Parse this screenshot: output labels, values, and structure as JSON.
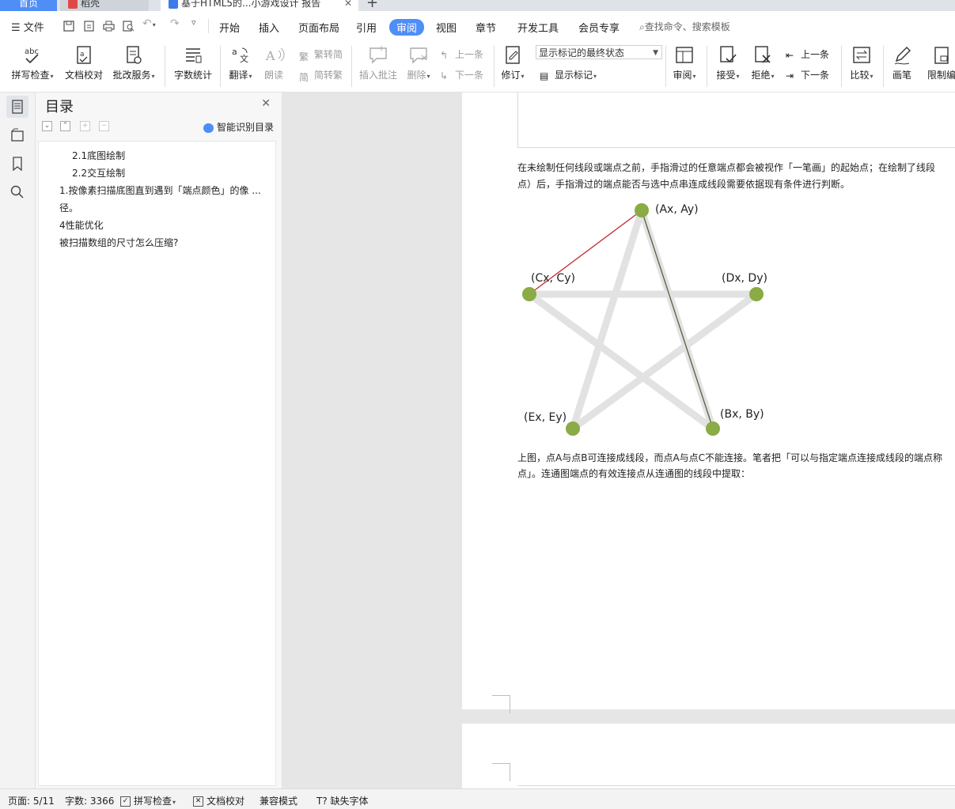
{
  "tabs": {
    "home": "首页",
    "daoke": "稻壳",
    "doc": "基于HTML5的...小游戏设计 报告"
  },
  "menu": {
    "file": "文件",
    "items": [
      "开始",
      "插入",
      "页面布局",
      "引用",
      "审阅",
      "视图",
      "章节",
      "开发工具",
      "会员专享"
    ],
    "active": "审阅",
    "search": "查找命令、搜索模板"
  },
  "ribbon": {
    "spell": "拼写检查",
    "proof": "文档校对",
    "review_service": "批改服务",
    "word_count": "字数统计",
    "translate": "翻译",
    "read_aloud": "朗读",
    "trad_to_simp": "繁转简",
    "simp_to_trad": "简转繁",
    "insert_comment": "插入批注",
    "delete": "删除",
    "prev_comment": "上一条",
    "next_comment": "下一条",
    "track": "修订",
    "markup_state": "显示标记的最终状态",
    "show_markup": "显示标记",
    "review_pane": "审阅",
    "accept": "接受",
    "reject": "拒绝",
    "prev_change": "上一条",
    "next_change": "下一条",
    "compare": "比较",
    "pen": "画笔",
    "restrict": "限制编"
  },
  "toc": {
    "title": "目录",
    "smart": "智能识别目录",
    "items": [
      "2.1底图绘制",
      "2.2交互绘制",
      "1.按像素扫描底图直到遇到「端点颜色」的像 ...",
      "径。",
      "4性能优化",
      "被扫描数组的尺寸怎么压缩?"
    ]
  },
  "document": {
    "para1_line1": "在未绘制任何线段或端点之前，手指滑过的任意端点都会被视作「一笔画」的起始点；在绘制了线段",
    "para1_line2": "点）后，手指滑过的端点能否与选中点串连成线段需要依据现有条件进行判断。",
    "para2_line1": "上图，点A与点B可连接成线段，而点A与点C不能连接。笔者把「可以与指定端点连接成线段的端点称",
    "para2_line2": "点」。连通图端点的有效连接点从连通图的线段中提取："
  },
  "chart_data": {
    "type": "diagram",
    "points": [
      {
        "label": "(Ax, Ay)"
      },
      {
        "label": "(Bx, By)"
      },
      {
        "label": "(Cx, Cy)"
      },
      {
        "label": "(Dx, Dy)"
      },
      {
        "label": "(Ex, Ey)"
      }
    ],
    "colors": {
      "point": "#8aab45",
      "edge": "#e2e2e2",
      "arrow_red": "#c0272d",
      "arrow_dark": "#5a5f3c"
    }
  },
  "status": {
    "page": "页面: 5/11",
    "words": "字数: 3366",
    "spell": "拼写检查",
    "proof": "文档校对",
    "compat": "兼容模式",
    "missing_font": "缺失字体"
  }
}
